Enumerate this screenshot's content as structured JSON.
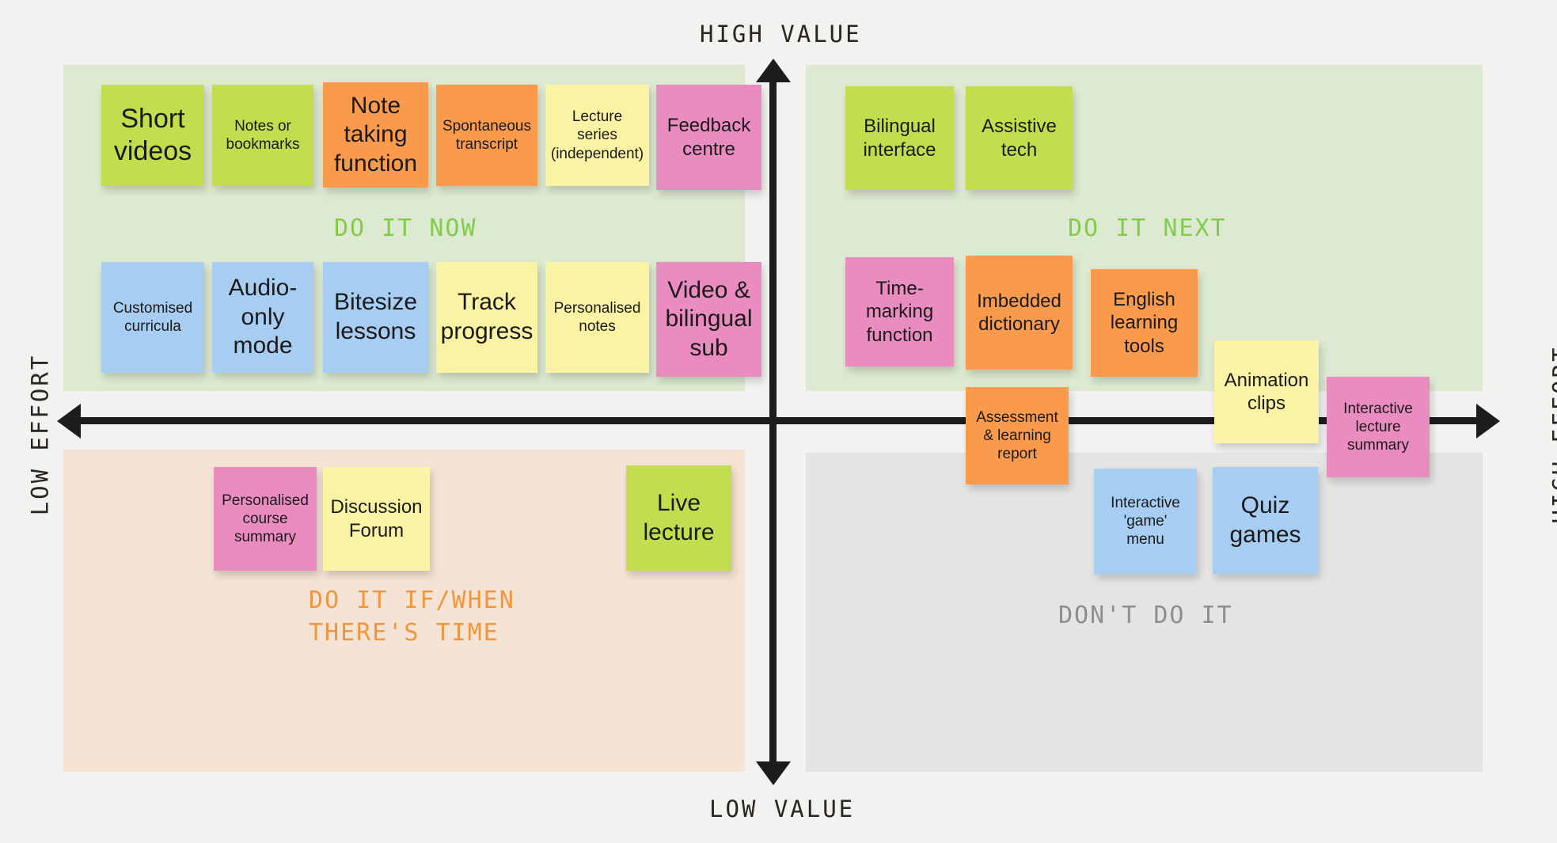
{
  "axes": {
    "top_label": "HIGH VALUE",
    "bottom_label": "LOW VALUE",
    "left_label": "LOW EFFORT",
    "right_label": "HIGH EFFORT"
  },
  "quadrants": {
    "top_left": {
      "caption": "DO IT NOW",
      "caption_color": "#82cc4b",
      "bg": "#dde9d1"
    },
    "top_right": {
      "caption": "DO IT NEXT",
      "caption_color": "#82cc4b",
      "bg": "#dde9d1"
    },
    "bottom_left": {
      "caption": "DO IT IF/WHEN\nTHERE'S TIME",
      "caption_color": "#f2963c",
      "bg": "#f5e3d5"
    },
    "bottom_right": {
      "caption": "DON'T DO IT",
      "caption_color": "#8e8e8c",
      "bg": "#e4e4e2"
    }
  },
  "palette": {
    "green": "#c2dd4e",
    "orange": "#fa9a4c",
    "yellow": "#faf3a4",
    "pink": "#eb8cc0",
    "blue": "#a7cdf2",
    "axis": "#1c1c1c",
    "page_bg": "#f2f2f0"
  },
  "notes": {
    "n01": "Short\nvideos",
    "n02": "Notes or\nbookmarks",
    "n03": "Note\ntaking\nfunction",
    "n04": "Spontaneous\ntranscript",
    "n05": "Lecture series\n(independent)",
    "n06": "Feedback\ncentre",
    "n07": "Customised\ncurricula",
    "n08": "Audio-\nonly\nmode",
    "n09": "Bitesize\nlessons",
    "n10": "Track\nprogress",
    "n11": "Personalised\nnotes",
    "n12": "Video &\nbilingual\nsub",
    "n13": "Bilingual\ninterface",
    "n14": "Assistive\ntech",
    "n15": "Time-\nmarking\nfunction",
    "n16": "Imbedded\ndictionary",
    "n17": "English\nlearning\ntools",
    "n18": "Animation\nclips",
    "n19": "Interactive\nlecture\nsummary",
    "n20": "Assessment\n& learning\nreport",
    "n21": "Interactive\n'game'\nmenu",
    "n22": "Quiz\ngames",
    "n23": "Personalised\ncourse\nsummary",
    "n24": "Discussion\nForum",
    "n25": "Live\nlecture"
  }
}
